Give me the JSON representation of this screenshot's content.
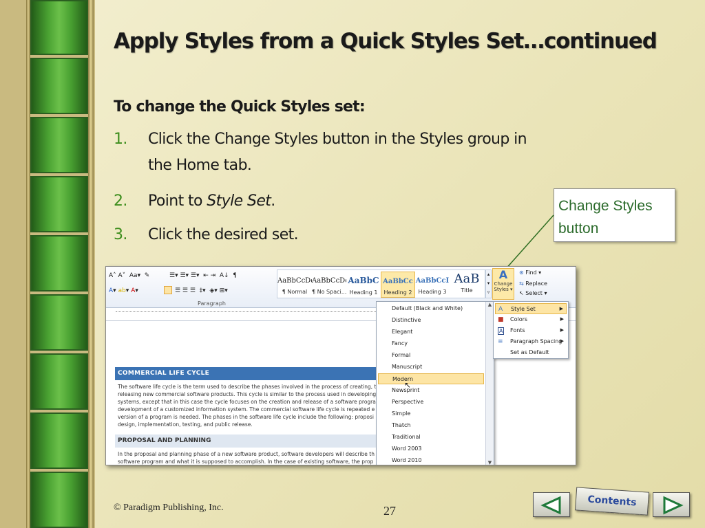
{
  "slide": {
    "title": "Apply Styles from a Quick Styles Set…continued",
    "subheading": "To change the Quick Styles set:",
    "steps": [
      {
        "num": "1.",
        "line1": "Click the Change Styles button in the Styles group in",
        "line2": "the Home tab."
      },
      {
        "num": "2.",
        "pre": "Point to ",
        "em": "Style Set",
        "post": "."
      },
      {
        "num": "3.",
        "text": "Click the desired set."
      }
    ],
    "callout": {
      "line1": "Change Styles",
      "line2": "button"
    },
    "footer": "© Paradigm Publishing, Inc.",
    "page_number": "27",
    "nav": {
      "prev_icon": "left-arrow-icon",
      "contents_label": "Contents",
      "next_icon": "right-arrow-icon"
    }
  },
  "screenshot": {
    "ribbon": {
      "paragraph_label": "Paragraph",
      "styles": [
        {
          "sample": "AaBbCcDc",
          "name": "¶ Normal"
        },
        {
          "sample": "AaBbCcDc",
          "name": "¶ No Spaci..."
        },
        {
          "sample": "AaBbC",
          "name": "Heading 1"
        },
        {
          "sample": "AaBbCc",
          "name": "Heading 2"
        },
        {
          "sample": "AaBbCcI",
          "name": "Heading 3"
        },
        {
          "sample": "AaB",
          "name": "Title"
        }
      ],
      "change_styles": {
        "line1": "Change",
        "line2": "Styles ▾"
      },
      "editing": {
        "find": "Find ▾",
        "replace": "Replace",
        "select": "Select ▾"
      }
    },
    "style_sets": [
      "Default (Black and White)",
      "Distinctive",
      "Elegant",
      "Fancy",
      "Formal",
      "Manuscript",
      "Modern",
      "Newsprint",
      "Perspective",
      "Simple",
      "Thatch",
      "Traditional",
      "Word 2003",
      "Word 2010"
    ],
    "highlighted_set": "Modern",
    "submenu": [
      {
        "label": "Style Set",
        "icon": "style-set-icon"
      },
      {
        "label": "Colors",
        "icon": "colors-icon"
      },
      {
        "label": "Fonts",
        "icon": "fonts-icon"
      },
      {
        "label": "Paragraph Spacing",
        "icon": "paragraph-spacing-icon"
      },
      {
        "label": "Set as Default",
        "icon": ""
      }
    ],
    "document": {
      "heading1": "COMMERCIAL LIFE CYCLE",
      "para1": [
        "The software life cycle is the term used to describe the phases involved in the process of creating, t",
        "releasing new commercial software products. This cycle is similar to the process used in developing",
        "systems, except that in this case the cycle focuses on the creation and release of a software progra",
        "development of a customized information system. The commercial software life cycle is repeated e",
        "version of a program is needed. The phases in the software life cycle include the following: proposi",
        "design, implementation, testing, and public release."
      ],
      "heading2": "PROPOSAL AND PLANNING",
      "para2": [
        "In the proposal and planning phase of a new software product, software developers will describe th",
        "software program and what it is supposed to accomplish. In the case of existing software, the prop"
      ]
    }
  }
}
